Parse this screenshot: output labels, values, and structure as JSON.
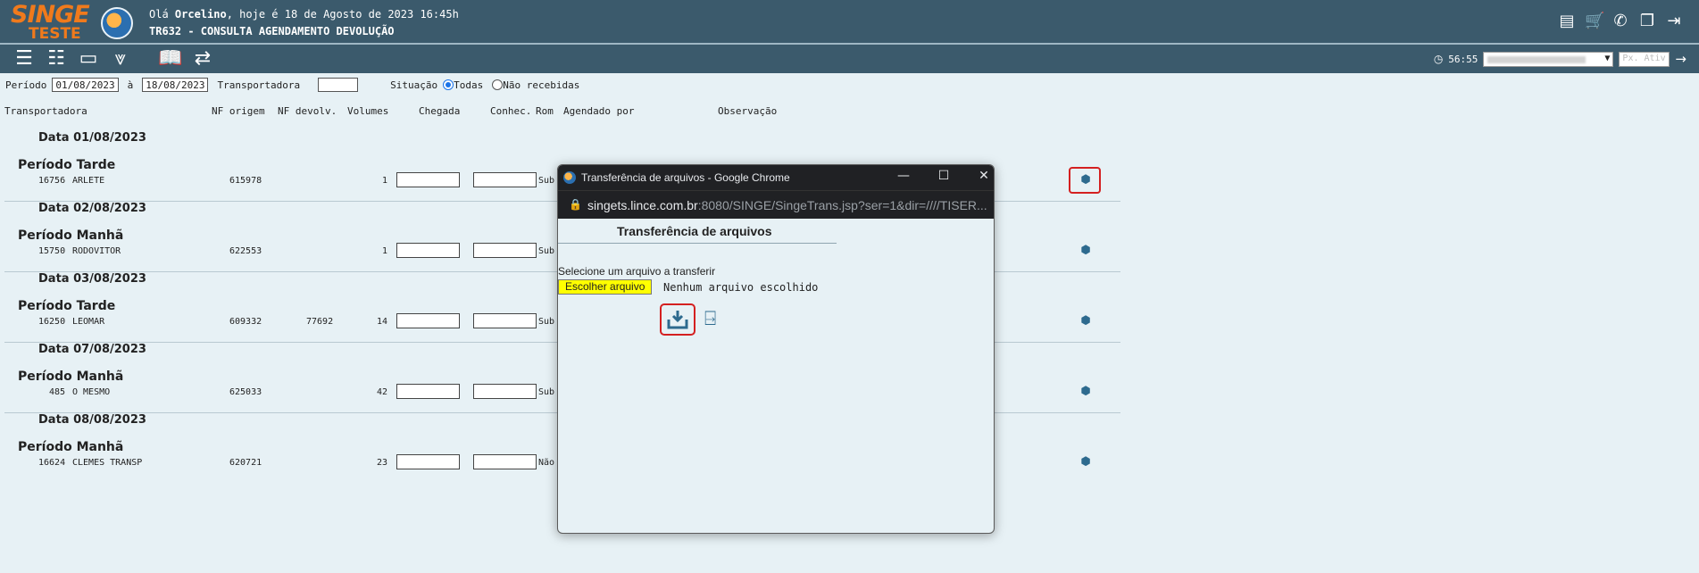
{
  "header": {
    "logo_top": "SINGE",
    "logo_bottom": "TESTE",
    "greeting_prefix": "Olá ",
    "user": "Orcelino",
    "greeting_suffix": ", hoje é 18 de Agosto de 2023 16:45h",
    "screen_title": "TR632 - CONSULTA AGENDAMENTO DEVOLUÇÃO"
  },
  "toolbar_right": {
    "timer": "56:55",
    "px_placeholder": "Px. Ativ"
  },
  "filters": {
    "periodo_label": "Período",
    "date_from": "01/08/2023",
    "to_label": "à",
    "date_to": "18/08/2023",
    "transportadora_label": "Transportadora",
    "transportadora_value": "",
    "situacao_label": "Situação",
    "opt_todas": "Todas",
    "opt_nao_recebidas": "Não recebidas"
  },
  "columns": {
    "transportadora": "Transportadora",
    "nf_origem": "NF origem",
    "nf_devolv": "NF devolv.",
    "volumes": "Volumes",
    "chegada": "Chegada",
    "conhec": "Conhec.",
    "rom": "Rom",
    "agendado_por": "Agendado por",
    "observacao": "Observação"
  },
  "groups": [
    {
      "date": "Data 01/08/2023",
      "period": "Período Tarde",
      "code": "16756",
      "name": "ARLETE",
      "nf_origem": "615978",
      "nf_devolv": "",
      "volumes": "1",
      "rom": "Sub"
    },
    {
      "date": "Data 02/08/2023",
      "period": "Período Manhã",
      "code": "15750",
      "name": "RODOVITOR",
      "nf_origem": "622553",
      "nf_devolv": "",
      "volumes": "1",
      "rom": "Sub"
    },
    {
      "date": "Data 03/08/2023",
      "period": "Período Tarde",
      "code": "16250",
      "name": "LEOMAR",
      "nf_origem": "609332",
      "nf_devolv": "77692",
      "volumes": "14",
      "rom": "Sub"
    },
    {
      "date": "Data 07/08/2023",
      "period": "Período Manhã",
      "code": "485",
      "name": "O MESMO",
      "nf_origem": "625033",
      "nf_devolv": "",
      "volumes": "42",
      "rom": "Sub"
    },
    {
      "date": "Data 08/08/2023",
      "period": "Período Manhã",
      "code": "16624",
      "name": "CLEMES TRANSP",
      "nf_origem": "620721",
      "nf_devolv": "",
      "volumes": "23",
      "rom": "Não"
    }
  ],
  "popup": {
    "window_title": "Transferência de arquivos - Google Chrome",
    "url_host": "singets.lince.com.br",
    "url_rest": ":8080/SINGE/SingeTrans.jsp?ser=1&dir=////TISER...",
    "heading": "Transferência de arquivos",
    "select_label": "Selecione um arquivo a transferir",
    "choose_button": "Escolher arquivo",
    "no_file": "Nenhum arquivo escolhido"
  },
  "colors": {
    "header_bg": "#3b5a6c",
    "page_bg": "#e7f1f5",
    "highlight": "#d42020",
    "accent_icon": "#2d6a8e",
    "file_button": "#ffff00"
  }
}
